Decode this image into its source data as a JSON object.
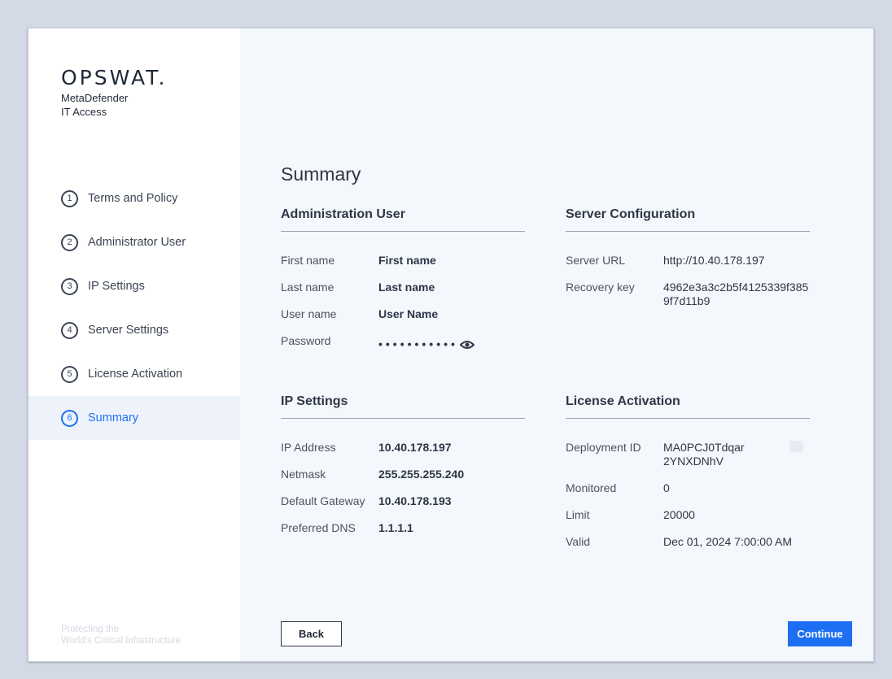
{
  "brand": {
    "logo": "OPSWAT.",
    "product_line1": "MetaDefender",
    "product_line2": "IT Access",
    "tagline_line1": "Protecting the",
    "tagline_line2": "World's Critical Infrastructure"
  },
  "steps": [
    {
      "num": "1",
      "label": "Terms and Policy"
    },
    {
      "num": "2",
      "label": "Administrator User"
    },
    {
      "num": "3",
      "label": "IP Settings"
    },
    {
      "num": "4",
      "label": "Server Settings"
    },
    {
      "num": "5",
      "label": "License Activation"
    },
    {
      "num": "6",
      "label": "Summary",
      "active": true
    }
  ],
  "page_title": "Summary",
  "admin": {
    "heading": "Administration User",
    "first_name_label": "First name",
    "first_name": "First name",
    "last_name_label": "Last name",
    "last_name": "Last name",
    "user_name_label": "User name",
    "user_name": "User Name",
    "password_label": "Password",
    "password_mask": "•••••••••••"
  },
  "server": {
    "heading": "Server Configuration",
    "url_label": "Server URL",
    "url": "http://10.40.178.197",
    "recovery_label": "Recovery key",
    "recovery_key": "4962e3a3c2b5f4125339f3859f7d11b9"
  },
  "ip": {
    "heading": "IP Settings",
    "address_label": "IP Address",
    "address": "10.40.178.197",
    "netmask_label": "Netmask",
    "netmask": "255.255.255.240",
    "gateway_label": "Default Gateway",
    "gateway": "10.40.178.193",
    "dns_label": "Preferred DNS",
    "dns": "1.1.1.1"
  },
  "license": {
    "heading": "License Activation",
    "deployment_label": "Deployment ID",
    "deployment_line1": "MA0PCJ0Tdqar",
    "deployment_line2": "2YNXDNhV",
    "monitored_label": "Monitored",
    "monitored": "0",
    "limit_label": "Limit",
    "limit": "20000",
    "valid_label": "Valid",
    "valid": "Dec 01, 2024 7:00:00 AM"
  },
  "buttons": {
    "back": "Back",
    "continue": "Continue"
  },
  "colors": {
    "accent": "#1d6ff2",
    "background": "#d3dae6"
  }
}
